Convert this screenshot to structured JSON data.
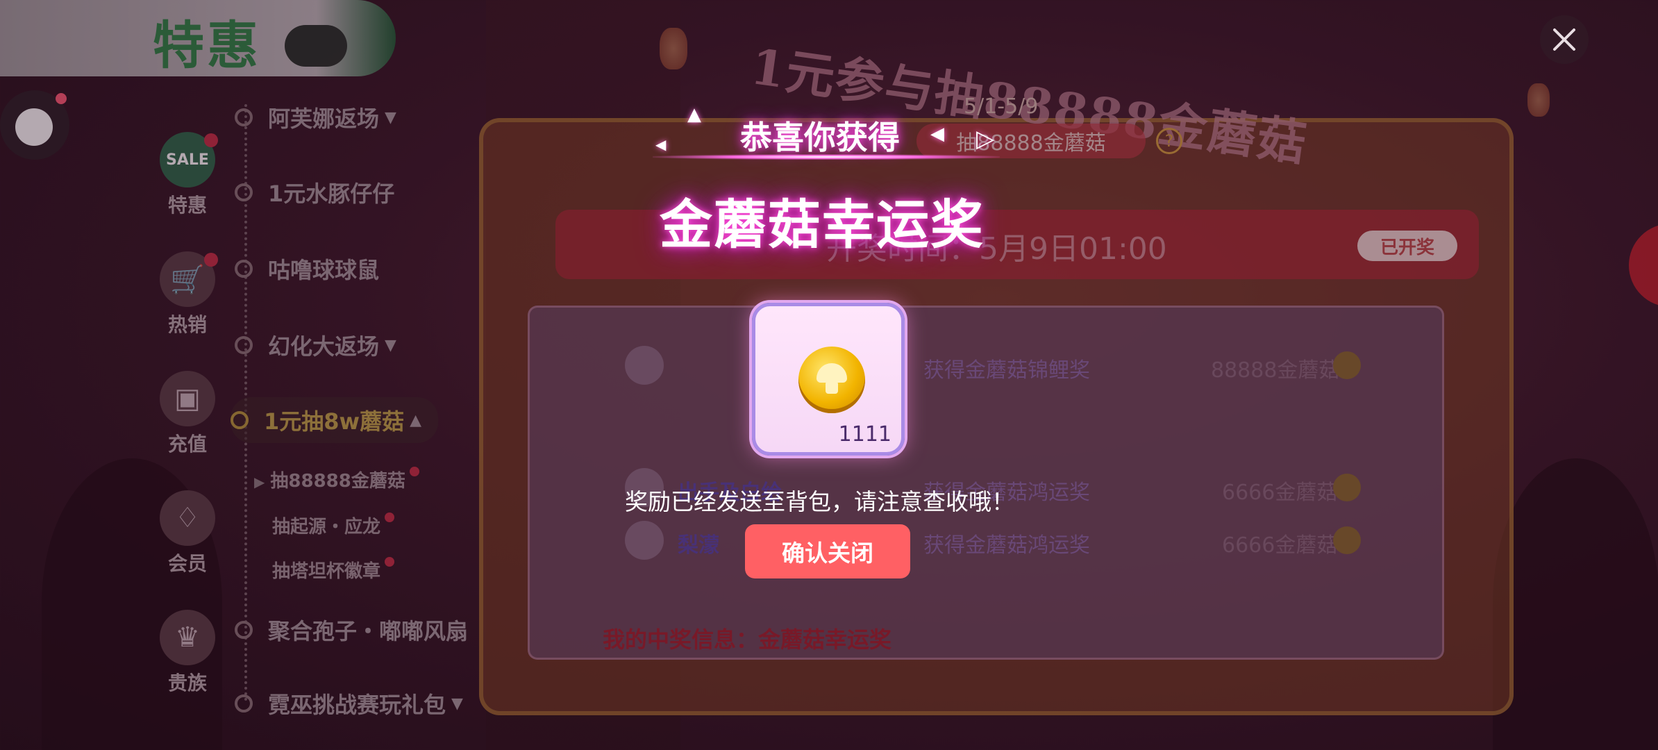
{
  "sidebar": {
    "promo_tab_label": "特惠",
    "categories": [
      {
        "label": "特惠",
        "icon": "sale-icon",
        "icon_text": "SALE"
      },
      {
        "label": "热销",
        "icon": "cart-icon"
      },
      {
        "label": "充值",
        "icon": "wallet-icon"
      },
      {
        "label": "会员",
        "icon": "diamond-icon"
      },
      {
        "label": "贵族",
        "icon": "crown-icon"
      }
    ],
    "sub_items": [
      {
        "label": "阿芙娜返场"
      },
      {
        "label": "1元水豚仔仔"
      },
      {
        "label": "咕噜球球鼠"
      },
      {
        "label": "幻化大返场"
      },
      {
        "label": "1元抽8w蘑菇"
      },
      {
        "label": "聚合孢子・嘟嘟风扇"
      },
      {
        "label": "霓巫挑战赛玩礼包"
      }
    ],
    "leaves": [
      "抽88888金蘑菇",
      "抽起源・应龙",
      "抽塔坦杯徽章"
    ]
  },
  "event": {
    "title": "1元参与抽88888金蘑菇",
    "date_range": "5/1-5/9",
    "banner": "抽88888金蘑菇",
    "draw_time": "开奖时间：5月9日01:00",
    "drawn_badge": "已开奖",
    "winners": [
      {
        "name": "",
        "prize": "获得金蘑菇锦鲤奖",
        "amount": "88888金蘑菇"
      },
      {
        "name": "出手及白给",
        "prize": "获得金蘑菇鸿运奖",
        "amount": "6666金蘑菇"
      },
      {
        "name": "梨濛",
        "prize": "获得金蘑菇鸿运奖",
        "amount": "6666金蘑菇"
      }
    ],
    "my_prize": "我的中奖信息：金蘑菇幸运奖"
  },
  "modal": {
    "congrats": "恭喜你获得",
    "prize_name": "金蘑菇幸运奖",
    "item_icon": "gold-mushroom-coin-icon",
    "item_count": "1111",
    "message": "奖励已经发送至背包，请注意查收哦！",
    "confirm_label": "确认关闭"
  },
  "colors": {
    "confirm_button": "#ff6064",
    "glow": "#ff4fd8"
  }
}
